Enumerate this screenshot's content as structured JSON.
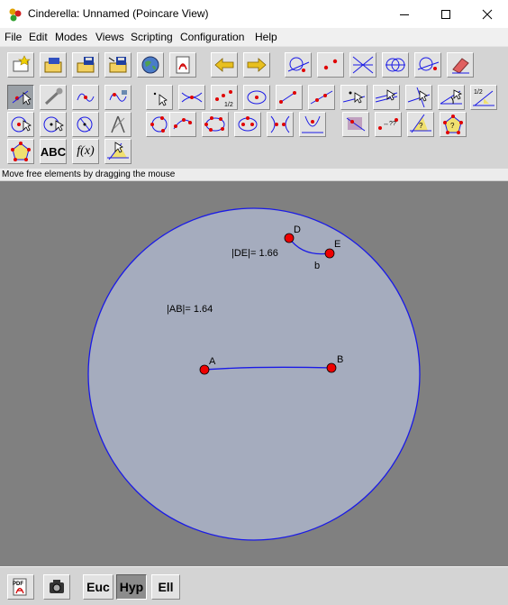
{
  "window": {
    "title": "Cinderella: Unnamed (Poincare View)"
  },
  "menu": {
    "items": [
      "File",
      "Edit",
      "Modes",
      "Views",
      "Scripting",
      "Configuration",
      "Help"
    ]
  },
  "toolbar": {
    "text_tool_label": "ABC",
    "function_tool_label": "f(x)"
  },
  "status": {
    "message": "Move free elements by dragging the mouse"
  },
  "geometry": {
    "point_labels": [
      "A",
      "B",
      "D",
      "E"
    ],
    "segment_label": "b",
    "measure_ab": "|AB|= 1.64",
    "measure_de": "|DE|= 1.66",
    "disk_fill": "#a5acbe",
    "line_color": "#1a1ae6",
    "point_color": "#ee0000"
  },
  "views": {
    "euclidean": "Euc",
    "hyperbolic": "Hyp",
    "elliptic": "Ell",
    "active": "Hyp"
  }
}
